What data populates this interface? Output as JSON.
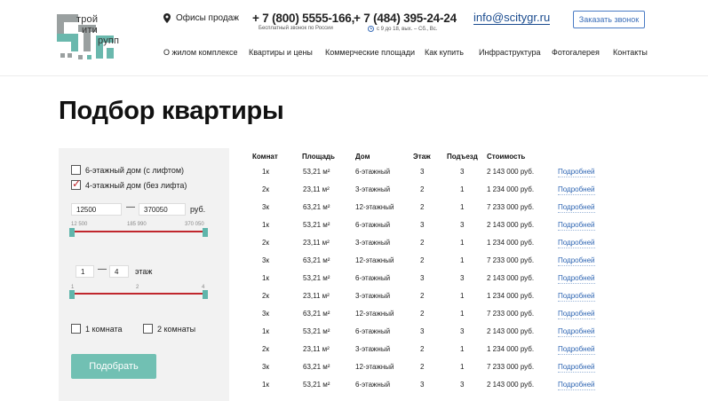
{
  "header": {
    "logo": {
      "line1": "трой",
      "line2": "ити",
      "line3": "рупп"
    },
    "office_label": "Офисы продаж",
    "phone1": {
      "number": "+ 7 (800) 5555-166,",
      "note": "Бесплатный звонок по России"
    },
    "phone2": {
      "number": "+ 7 (484) 395-24-24",
      "note": "с 9 до 18, вых. – Сб., Вс."
    },
    "email": "info@scitygr.ru",
    "callback_label": "Заказать звонок",
    "nav": [
      "О жилом комплексе",
      "Квартиры и цены",
      "Коммерческие площади",
      "Как купить",
      "Инфраструктура",
      "Фотогалерея",
      "Контакты"
    ]
  },
  "page_title": "Подбор квартиры",
  "filter": {
    "houses": [
      {
        "label": "6-этажный дом (с лифтом)",
        "checked": false
      },
      {
        "label": "4-этажный дом (без лифта)",
        "checked": true
      }
    ],
    "price": {
      "from": "12500",
      "to": "370050",
      "unit": "руб.",
      "ticks": [
        "12 500",
        "185 990",
        "370 050"
      ]
    },
    "floor": {
      "from": "1",
      "to": "4",
      "unit": "этаж",
      "ticks": [
        "1",
        "2",
        "4"
      ]
    },
    "rooms": [
      {
        "label": "1 комната",
        "checked": false
      },
      {
        "label": "2 комнаты",
        "checked": false
      }
    ],
    "submit_label": "Подобрать"
  },
  "table": {
    "headers": [
      "Комнат",
      "Площадь",
      "Дом",
      "Этаж",
      "Подъезд",
      "Стоимость"
    ],
    "more_label": "Подробней",
    "rows": [
      [
        "1к",
        "53,21 м²",
        "6-этажный",
        "3",
        "3",
        "2 143 000 руб."
      ],
      [
        "2к",
        "23,11 м²",
        "3-этажный",
        "2",
        "1",
        "1 234 000 руб."
      ],
      [
        "3к",
        "63,21 м²",
        "12-этажный",
        "2",
        "1",
        "7 233 000 руб."
      ],
      [
        "1к",
        "53,21 м²",
        "6-этажный",
        "3",
        "3",
        "2 143 000 руб."
      ],
      [
        "2к",
        "23,11 м²",
        "3-этажный",
        "2",
        "1",
        "1 234 000 руб."
      ],
      [
        "3к",
        "63,21 м²",
        "12-этажный",
        "2",
        "1",
        "7 233 000 руб."
      ],
      [
        "1к",
        "53,21 м²",
        "6-этажный",
        "3",
        "3",
        "2 143 000 руб."
      ],
      [
        "2к",
        "23,11 м²",
        "3-этажный",
        "2",
        "1",
        "1 234 000 руб."
      ],
      [
        "3к",
        "63,21 м²",
        "12-этажный",
        "2",
        "1",
        "7 233 000 руб."
      ],
      [
        "1к",
        "53,21 м²",
        "6-этажный",
        "3",
        "3",
        "2 143 000 руб."
      ],
      [
        "2к",
        "23,11 м²",
        "3-этажный",
        "2",
        "1",
        "1 234 000 руб."
      ],
      [
        "3к",
        "63,21 м²",
        "12-этажный",
        "2",
        "1",
        "7 233 000 руб."
      ],
      [
        "1к",
        "53,21 м²",
        "6-этажный",
        "3",
        "3",
        "2 143 000 руб."
      ]
    ]
  },
  "colors": {
    "accent": "#71c0b3",
    "slider": "#c0272d",
    "link": "#2f66b3"
  }
}
